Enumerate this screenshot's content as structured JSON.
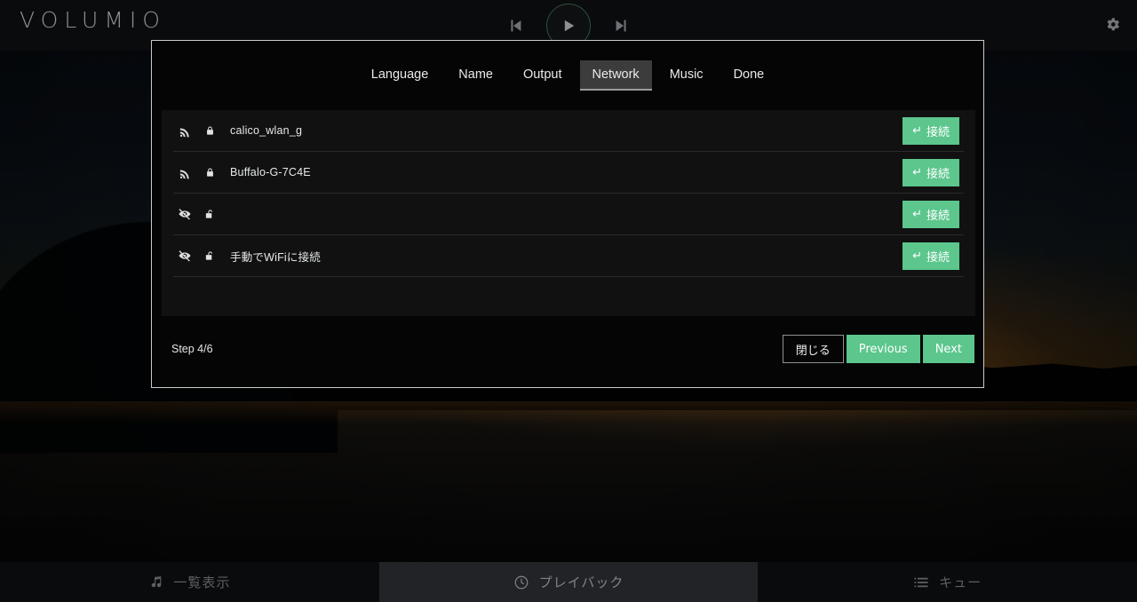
{
  "app": {
    "logo": "VOLUMIO"
  },
  "topbar": {
    "prev_icon": "skip-previous-icon",
    "play_icon": "play-icon",
    "next_icon": "skip-next-icon",
    "settings_icon": "gear-icon"
  },
  "wizard": {
    "tabs": [
      {
        "label": "Language",
        "active": false
      },
      {
        "label": "Name",
        "active": false
      },
      {
        "label": "Output",
        "active": false
      },
      {
        "label": "Network",
        "active": true
      },
      {
        "label": "Music",
        "active": false
      },
      {
        "label": "Done",
        "active": false
      }
    ],
    "networks": [
      {
        "ssid": "calico_wlan_g",
        "signal_icon": "wifi-icon",
        "lock_icon": "lock-closed-icon",
        "secured": true,
        "action": "↵ 接続"
      },
      {
        "ssid": "Buffalo-G-7C4E",
        "signal_icon": "wifi-icon",
        "lock_icon": "lock-closed-icon",
        "secured": true,
        "action": "↵ 接続"
      },
      {
        "ssid": "",
        "signal_icon": "eye-slash-icon",
        "lock_icon": "lock-open-icon",
        "secured": false,
        "action": "↵ 接続"
      },
      {
        "ssid": "手動でWiFiに接続",
        "signal_icon": "eye-slash-icon",
        "lock_icon": "lock-open-icon",
        "secured": false,
        "action": "↵ 接続"
      }
    ],
    "connect_label": "接続",
    "connect_glyph": "↵",
    "step": "Step 4/6",
    "buttons": {
      "close": "閉じる",
      "previous": "Previous",
      "next": "Next"
    }
  },
  "bottomnav": [
    {
      "label": "一覧表示",
      "icon": "music-note-icon",
      "active": false
    },
    {
      "label": "プレイバック",
      "icon": "playback-disc-icon",
      "active": true
    },
    {
      "label": "キュー",
      "icon": "queue-list-icon",
      "active": false
    }
  ],
  "colors": {
    "accent_green": "#5cc68d",
    "panel": "#111111",
    "modal_border": "#c9cbc9",
    "active_tab": "#3c3c3c"
  }
}
